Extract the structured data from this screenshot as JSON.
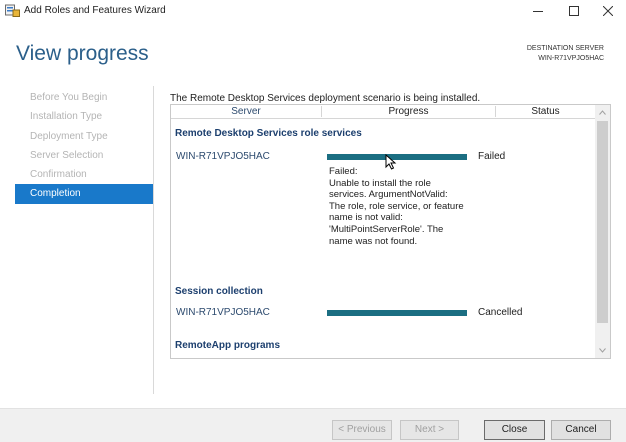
{
  "window": {
    "title": "Add Roles and Features Wizard",
    "minimize": "–",
    "maximize": "☐",
    "close": "✕"
  },
  "header": {
    "title": "View progress",
    "destination_label": "DESTINATION SERVER",
    "destination_server": "WIN-R71VPJO5HAC"
  },
  "nav": {
    "items": [
      {
        "label": "Before You Begin",
        "active": false
      },
      {
        "label": "Installation Type",
        "active": false
      },
      {
        "label": "Deployment Type",
        "active": false
      },
      {
        "label": "Server Selection",
        "active": false
      },
      {
        "label": "Confirmation",
        "active": false
      },
      {
        "label": "Completion",
        "active": true
      }
    ]
  },
  "main": {
    "intro": "The Remote Desktop Services deployment scenario is being installed.",
    "columns": {
      "server": "Server",
      "progress": "Progress",
      "status": "Status"
    },
    "sections": [
      {
        "title": "Remote Desktop Services role services",
        "server": "WIN-R71VPJO5HAC",
        "progress": 1.0,
        "status": "Failed",
        "detail_lines": [
          "Failed:",
          "Unable to install the role",
          "services. ArgumentNotValid:",
          "The role, role service, or feature",
          "name is not valid:",
          "'MultiPointServerRole'. The",
          "name was not found."
        ]
      },
      {
        "title": "Session collection",
        "server": "WIN-R71VPJO5HAC",
        "progress": 1.0,
        "status": "Cancelled"
      },
      {
        "title": "RemoteApp programs"
      }
    ]
  },
  "footer": {
    "previous": "< Previous",
    "next": "Next >",
    "close": "Close",
    "cancel": "Cancel"
  },
  "colors": {
    "accent": "#1979ca",
    "title": "#2b5f8a",
    "progress_bar": "#1b6e82"
  }
}
